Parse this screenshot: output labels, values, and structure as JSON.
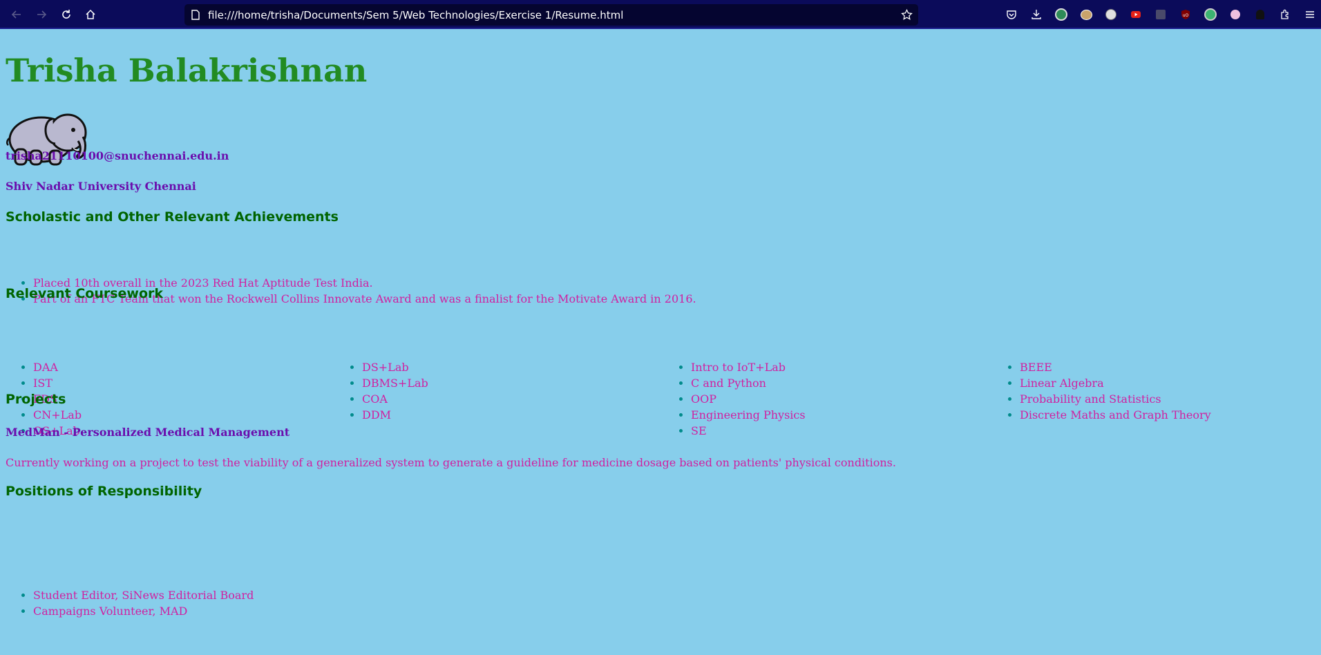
{
  "browser": {
    "url": "file:///home/trisha/Documents/Sem 5/Web Technologies/Exercise 1/Resume.html",
    "icons": {
      "back": "arrow-left-icon",
      "forward": "arrow-right-icon",
      "reload": "reload-icon",
      "home": "home-icon",
      "page": "page-icon",
      "bookmark": "star-icon"
    },
    "toolbar_icons": [
      "pocket-icon",
      "download-icon",
      "extension-1-icon",
      "extension-2-icon",
      "extension-3-icon",
      "youtube-icon",
      "extension-5-icon",
      "ublock-icon",
      "extension-7-icon",
      "extension-8-icon",
      "extension-9-icon",
      "extensions-icon",
      "menu-icon"
    ]
  },
  "resume": {
    "name": "Trisha Balakrishnan",
    "avatar": "elephant-image",
    "email": "trisha21110100@snuchennai.edu.in",
    "university": "Shiv Nadar University Chennai",
    "achievements": {
      "heading": "Scholastic and Other Relevant Achievements",
      "items": [
        "Placed 10th overall in the 2023 Red Hat Aptitude Test India.",
        "Part of an FTC Team that won the Rockwell Collins Innovate Award and was a finalist for the Motivate Award in 2016."
      ]
    },
    "coursework": {
      "heading": "Relevant Coursework",
      "columns": [
        [
          "DAA",
          "IST",
          "FDS",
          "CN+Lab",
          "OS+Lab"
        ],
        [
          "DS+Lab",
          "DBMS+Lab",
          "COA",
          "DDM"
        ],
        [
          "Intro to IoT+Lab",
          "C and Python",
          "OOP",
          "Engineering Physics",
          "SE"
        ],
        [
          "BEEE",
          "Linear Algebra",
          "Probability and Statistics",
          "Discrete Maths and Graph Theory"
        ]
      ]
    },
    "projects": {
      "heading": "Projects",
      "title": "MedMan - Personalized Medical Management",
      "description": "Currently working on a project to test the viability of a generalized system to generate a guideline for medicine dosage based on patients' physical conditions."
    },
    "positions": {
      "heading": "Positions of Responsibility",
      "items": [
        "Student Editor, SiNews Editorial Board",
        "Campaigns Volunteer, MAD"
      ]
    }
  },
  "colors": {
    "background": "#87ceeb",
    "name": "#228b22",
    "heading": "#006400",
    "info": "#6a0dad",
    "text": "#d020a0",
    "bullet": "#008b8b",
    "toolbar": "#0b0b5a"
  }
}
